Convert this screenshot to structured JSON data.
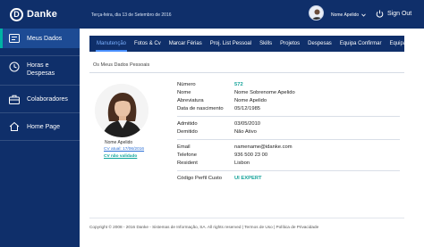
{
  "brand": {
    "name": "Danke",
    "mark": "D"
  },
  "header": {
    "date": "Terça-feira, dia 13 de Setembro de 2016",
    "user_name": "Nome Apelido",
    "signout_label": "Sign Out"
  },
  "sidebar": {
    "items": [
      {
        "label": "Meus Dados",
        "icon": "id-card-icon",
        "active": true
      },
      {
        "label_line1": "Horas e",
        "label_line2": "Despesas",
        "icon": "clock-icon"
      },
      {
        "label": "Colaboradores",
        "icon": "briefcase-icon"
      },
      {
        "label": "Home Page",
        "icon": "home-icon"
      }
    ]
  },
  "tabs": [
    {
      "label": "Manutenção",
      "active": true
    },
    {
      "label": "Fotos & Cv"
    },
    {
      "label": "Marcar Férias"
    },
    {
      "label": "Proj. List Pessoal"
    },
    {
      "label": "Skills"
    },
    {
      "label": "Projetos"
    },
    {
      "label": "Despesas"
    },
    {
      "label": "Equipa Confirmar"
    },
    {
      "label": "Equipa Atualizar"
    }
  ],
  "section": {
    "title": "Os Meus Dados Pessoais"
  },
  "profile": {
    "name": "Nome Apelido",
    "cv_current": "CV atual: 17/06/2016",
    "cv_unvalidated": "CV não validado"
  },
  "fields": {
    "numero": {
      "label": "Número",
      "value": "572"
    },
    "nome": {
      "label": "Nome",
      "value": "Nome Sobrenome Apelido"
    },
    "abreviatura": {
      "label": "Abreviatura",
      "value": "Nome Apelido"
    },
    "nascimento": {
      "label": "Data de nascimento",
      "value": "05/12/1985"
    },
    "admitido": {
      "label": "Admitido",
      "value": "03/05/2010"
    },
    "demitido": {
      "label": "Demitido",
      "value": "Não Ativo"
    },
    "email": {
      "label": "Email",
      "value": "namename@idanke.com"
    },
    "telefone": {
      "label": "Telefone",
      "value": "936 500 23 00"
    },
    "residente": {
      "label": "Resident",
      "value": "Lisbon"
    },
    "perfil": {
      "label": "Código Perfil Custo",
      "value": "UI EXPERT"
    }
  },
  "footer": {
    "copyright": "Copyright © 2008 - 2016 Danke - Sistemas de Informação, SA. All rights reserved",
    "sep": "|",
    "terms": "Termos de Uso",
    "privacy": "Política de Privacidade"
  },
  "colors": {
    "navy": "#0f2f6a",
    "accent_teal": "#16a39a",
    "tab_active": "#4a90ff"
  }
}
